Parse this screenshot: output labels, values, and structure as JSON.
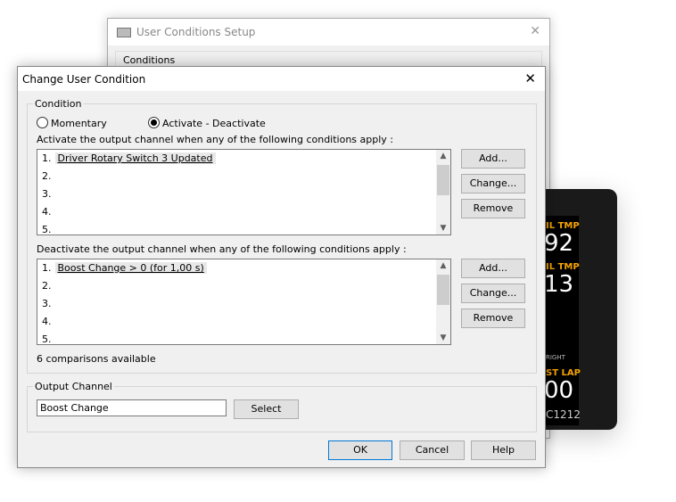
{
  "background_window": {
    "title": "User Conditions Setup",
    "group": "Conditions"
  },
  "device": {
    "labels": [
      "IL TMP",
      "IL TMP",
      "RIGHT",
      "ST LAP"
    ],
    "values": [
      "92",
      "13",
      "00"
    ],
    "brand": "C1212"
  },
  "dialog": {
    "title": "Change User Condition",
    "condition_group": "Condition",
    "mode_options": [
      {
        "label": "Momentary",
        "selected": false
      },
      {
        "label": "Activate - Deactivate",
        "selected": true
      }
    ],
    "activate_label": "Activate the output channel when any of the following conditions apply :",
    "activate_items": [
      "Driver Rotary Switch 3 Updated",
      "",
      "",
      "",
      ""
    ],
    "deactivate_label": "Deactivate the output channel when any of the following conditions apply :",
    "deactivate_items": [
      "Boost Change > 0 (for 1,00 s)",
      "",
      "",
      "",
      ""
    ],
    "add_label": "Add...",
    "change_label": "Change...",
    "remove_label": "Remove",
    "comparisons": "6 comparisons available",
    "output_group": "Output Channel",
    "output_value": "Boost Change",
    "select_label": "Select",
    "ok_label": "OK",
    "cancel_label": "Cancel",
    "help_label": "Help"
  }
}
